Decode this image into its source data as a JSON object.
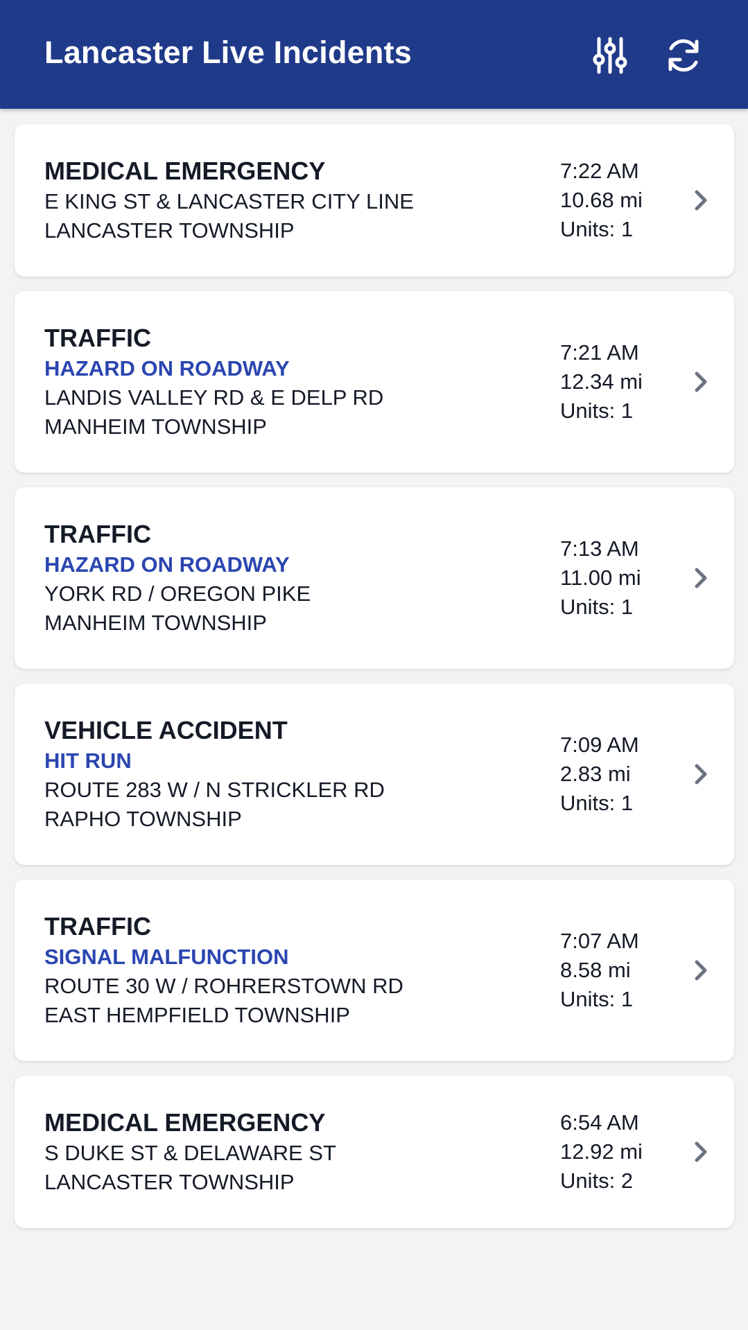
{
  "header": {
    "title": "Lancaster Live Incidents",
    "filter_icon": "sliders-icon",
    "refresh_icon": "refresh-icon",
    "background_color": "#203a8a"
  },
  "colors": {
    "subtype": "#2b46b0",
    "chevron": "#6b7280",
    "page_background": "#f2f3f5"
  },
  "incidents": [
    {
      "type": "MEDICAL EMERGENCY",
      "subtype": "",
      "location": "E KING ST & LANCASTER CITY LINE",
      "municipality": "LANCASTER TOWNSHIP",
      "time": "7:22 AM",
      "distance": "10.68 mi",
      "units": "Units: 1"
    },
    {
      "type": "TRAFFIC",
      "subtype": "HAZARD ON ROADWAY",
      "location": "LANDIS VALLEY RD & E DELP RD",
      "municipality": "MANHEIM TOWNSHIP",
      "time": "7:21 AM",
      "distance": "12.34 mi",
      "units": "Units: 1"
    },
    {
      "type": "TRAFFIC",
      "subtype": "HAZARD ON ROADWAY",
      "location": "YORK RD / OREGON PIKE",
      "municipality": "MANHEIM TOWNSHIP",
      "time": "7:13 AM",
      "distance": "11.00 mi",
      "units": "Units: 1"
    },
    {
      "type": "VEHICLE ACCIDENT",
      "subtype": "HIT RUN",
      "location": "ROUTE 283 W / N STRICKLER RD",
      "municipality": "RAPHO TOWNSHIP",
      "time": "7:09 AM",
      "distance": "2.83 mi",
      "units": "Units: 1"
    },
    {
      "type": "TRAFFIC",
      "subtype": "SIGNAL MALFUNCTION",
      "location": "ROUTE 30 W / ROHRERSTOWN RD",
      "municipality": "EAST HEMPFIELD TOWNSHIP",
      "time": "7:07 AM",
      "distance": "8.58 mi",
      "units": "Units: 1"
    },
    {
      "type": "MEDICAL EMERGENCY",
      "subtype": "",
      "location": "S DUKE ST & DELAWARE ST",
      "municipality": "LANCASTER TOWNSHIP",
      "time": "6:54 AM",
      "distance": "12.92 mi",
      "units": "Units: 2"
    }
  ]
}
